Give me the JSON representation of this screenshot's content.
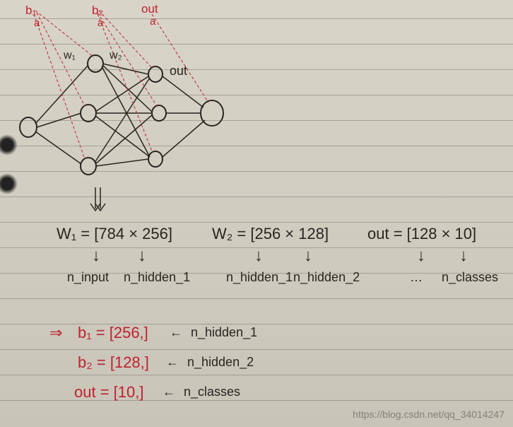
{
  "diagram_labels": {
    "top_b1": "b₁",
    "top_b2": "b₂",
    "top_out": "out",
    "a1": "a",
    "a2": "a",
    "a3": "a",
    "w1": "w₁",
    "w2": "w₂",
    "out_side": "out"
  },
  "weights": {
    "w1_expr": "W₁ = [784 × 256]",
    "w2_expr": "W₂ = [256 × 128]",
    "out_expr": "out = [128 × 10]",
    "w1_left": "n_input",
    "w1_right": "n_hidden_1",
    "w2_left": "n_hidden_1",
    "w2_right": "n_hidden_2",
    "out_left": "…",
    "out_right": "n_classes"
  },
  "biases": {
    "arrow": "⇒",
    "b1_lhs": "b₁ = [256,]",
    "b1_rhs": "n_hidden_1",
    "b2_lhs": "b₂ = [128,]",
    "b2_rhs": "n_hidden_2",
    "out_lhs": "out = [10,]",
    "out_rhs": "n_classes"
  },
  "watermark": "https://blog.csdn.net/qq_34014247",
  "chart_data": {
    "type": "diagram",
    "description": "Hand-drawn multilayer perceptron architecture on lined paper",
    "layers": [
      {
        "name": "input",
        "size": 784,
        "drawn_nodes": 1
      },
      {
        "name": "hidden_1",
        "size": 256,
        "drawn_nodes": 3,
        "bias": "b1",
        "activation": "a"
      },
      {
        "name": "hidden_2",
        "size": 128,
        "drawn_nodes": 3,
        "bias": "b2",
        "activation": "a"
      },
      {
        "name": "output",
        "size": 10,
        "drawn_nodes": 1,
        "label": "out",
        "activation": "a"
      }
    ],
    "weight_matrices": [
      {
        "name": "W1",
        "shape": [
          784,
          256
        ],
        "from": "n_input",
        "to": "n_hidden_1"
      },
      {
        "name": "W2",
        "shape": [
          256,
          128
        ],
        "from": "n_hidden_1",
        "to": "n_hidden_2"
      },
      {
        "name": "out",
        "shape": [
          128,
          10
        ],
        "from": "n_hidden_2",
        "to": "n_classes"
      }
    ],
    "bias_vectors": [
      {
        "name": "b1",
        "shape": [
          256
        ],
        "equals": "n_hidden_1"
      },
      {
        "name": "b2",
        "shape": [
          128
        ],
        "equals": "n_hidden_2"
      },
      {
        "name": "out",
        "shape": [
          10
        ],
        "equals": "n_classes"
      }
    ]
  }
}
